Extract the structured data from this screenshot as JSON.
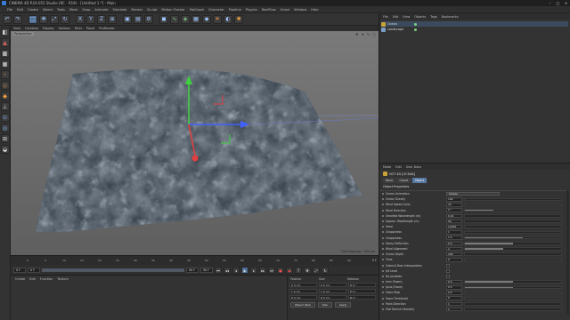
{
  "window": {
    "title": "CINEMA 4D R19.055 Studio (RC - R19) - [Untitled 1 *] - Main",
    "controls": [
      "minimize-icon",
      "maximize-icon",
      "close-icon"
    ]
  },
  "menubar": {
    "items": [
      "File",
      "Edit",
      "Create",
      "Select",
      "Tools",
      "Mesh",
      "Snap",
      "Animate",
      "Simulate",
      "Render",
      "Sculpt",
      "Motion Tracker",
      "MoGraph",
      "Character",
      "Pipeline",
      "Plugins",
      "RealFlow",
      "Script",
      "Window",
      "Help"
    ],
    "layout_label": "Layout:",
    "layout_value": "Startup"
  },
  "viewport": {
    "menu": [
      "View",
      "Cameras",
      "Display",
      "Options",
      "Filter",
      "Panel",
      "ProRender"
    ],
    "label": "Perspective",
    "grid_spacing": "Grid Spacing : 100 cm"
  },
  "timeline": {
    "ticks": [
      "0",
      "5",
      "10",
      "15",
      "20",
      "25",
      "30",
      "35",
      "40",
      "45",
      "50",
      "55",
      "60",
      "65",
      "70",
      "75",
      "80",
      "85",
      "90"
    ],
    "frame_end": "0 F"
  },
  "transport": {
    "start": "0 F",
    "current": "0 F",
    "end": "90 F",
    "end2": "90 F"
  },
  "material_manager": {
    "menu": [
      "Create",
      "Edit",
      "Function",
      "Texture"
    ]
  },
  "coordinates": {
    "headers": [
      "Position",
      "Size",
      "Rotation"
    ],
    "rows": [
      [
        "X  0 cm",
        "X  0 cm",
        "H  0 °"
      ],
      [
        "Y  0 cm",
        "Y  0 cm",
        "P  0 °"
      ],
      [
        "Z  0 cm",
        "Z  0 cm",
        "B  0 °"
      ]
    ],
    "mode_options": [
      "Object (Rel)",
      "Size"
    ],
    "apply_label": "Apply"
  },
  "object_manager": {
    "menu": [
      "File",
      "Edit",
      "View",
      "Objects",
      "Tags",
      "Bookmarks"
    ],
    "objects": [
      {
        "name": "Ocean",
        "type": "deformer"
      },
      {
        "name": "Landscape",
        "type": "mesh"
      }
    ]
  },
  "attribute_manager": {
    "menu": [
      "Mode",
      "Edit",
      "User Data"
    ],
    "object_title": "HOT 4D [OCEAN]",
    "tabs": [
      "Basic",
      "Coord.",
      "Object"
    ],
    "active_tab": "Object",
    "section": "Object Properties",
    "properties": [
      {
        "name": "Ocean Animation",
        "kind": "select",
        "value": "Simple"
      },
      {
        "name": "Ocean Gravity",
        "kind": "value",
        "value": "100",
        "fill": 0
      },
      {
        "name": "Wind Speed (m/s)",
        "kind": "value",
        "value": "20",
        "fill": 0
      },
      {
        "name": "Wind Direction",
        "kind": "value",
        "value": "0 °",
        "fill": 0.3
      },
      {
        "name": "Smallest Wavelength (m)",
        "kind": "value",
        "value": "0.01",
        "fill": 0
      },
      {
        "name": "Approx. Wavelength (m)",
        "kind": "value",
        "value": "50",
        "fill": 0
      },
      {
        "name": "Seed",
        "kind": "value",
        "value": "12345",
        "fill": 0
      },
      {
        "name": "Choppiness",
        "kind": "value",
        "value": "1",
        "fill": 0
      },
      {
        "name": "Choppiness",
        "kind": "value",
        "value": "1.5",
        "fill": 0.6
      },
      {
        "name": "Damp Reflection",
        "kind": "value",
        "value": "0.5",
        "fill": 0.5
      },
      {
        "name": "Wind Alignment",
        "kind": "value",
        "value": "2",
        "fill": 0.4
      },
      {
        "name": "Ocean Depth",
        "kind": "value",
        "value": "200",
        "fill": 0
      },
      {
        "name": "Time",
        "kind": "value",
        "value": "0",
        "fill": 0
      },
      {
        "name": "Catmull-Rom Interpolation",
        "kind": "check",
        "value": ""
      },
      {
        "name": "Jet Level",
        "kind": "check",
        "value": ""
      },
      {
        "name": "Do Jacobian",
        "kind": "check",
        "value": ""
      },
      {
        "name": "Jmin (Foam)",
        "kind": "value",
        "value": "0.5",
        "fill": 0.5
      },
      {
        "name": "Jplus (Foam)",
        "kind": "value",
        "value": "0.5",
        "fill": 0.5
      },
      {
        "name": "Foam Map",
        "kind": "value",
        "value": "0.5",
        "fill": 0
      },
      {
        "name": "Foam Threshold",
        "kind": "value",
        "value": "0",
        "fill": 0
      },
      {
        "name": "Point Direction",
        "kind": "value",
        "value": "1",
        "fill": 0
      },
      {
        "name": "Plot Tarnish Intensity",
        "kind": "value",
        "value": "1",
        "fill": 0
      }
    ]
  },
  "colors": {
    "accent": "#5677a0",
    "axis_x": "#e04040",
    "axis_y": "#40d040",
    "axis_z": "#4060ff",
    "terrain": "#3b4550"
  }
}
